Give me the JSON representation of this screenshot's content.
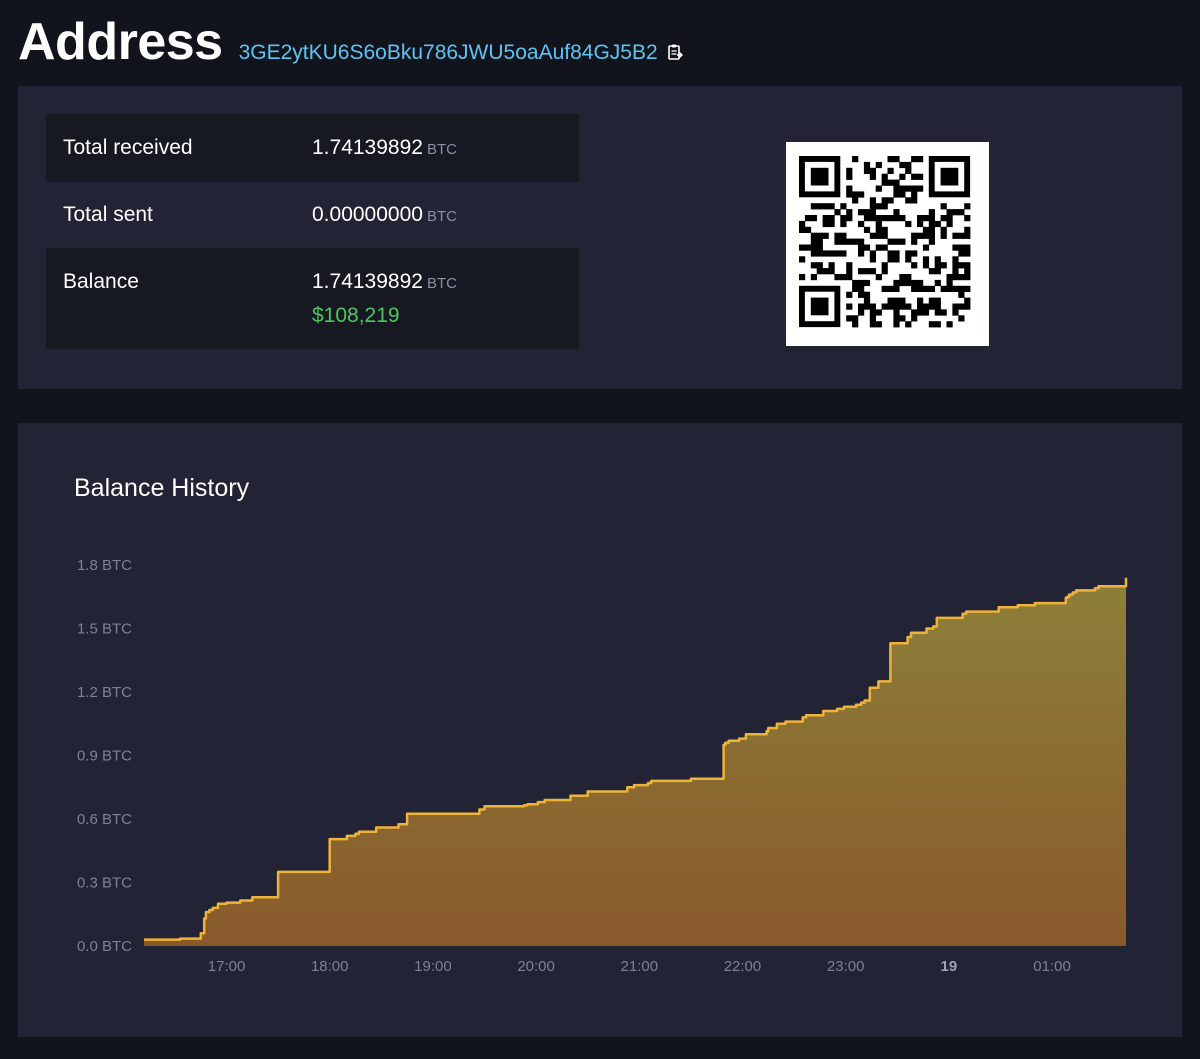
{
  "header": {
    "title": "Address",
    "address": "3GE2ytKU6S6oBku786JWU5oaAuf84GJ5B2"
  },
  "stats": {
    "total_received_label": "Total received",
    "total_received_value": "1.74139892",
    "total_sent_label": "Total sent",
    "total_sent_value": "0.00000000",
    "balance_label": "Balance",
    "balance_value": "1.74139892",
    "balance_usd": "$108,219",
    "unit": "BTC"
  },
  "colors": {
    "line": "#f0b33a",
    "usd": "#4cc75a",
    "address": "#5ec4f2"
  },
  "chart_data": {
    "type": "area",
    "title": "Balance History",
    "xlabel": "",
    "ylabel": "",
    "ylim": [
      0,
      1.8
    ],
    "yticks": [
      "0.0 BTC",
      "0.3 BTC",
      "0.6 BTC",
      "0.9 BTC",
      "1.2 BTC",
      "1.5 BTC",
      "1.8 BTC"
    ],
    "xticks": [
      "17:00",
      "18:00",
      "19:00",
      "20:00",
      "21:00",
      "22:00",
      "23:00",
      "19",
      "01:00"
    ],
    "grid": false,
    "x": [
      "16:12",
      "16:33",
      "16:45",
      "16:47",
      "16:48",
      "16:50",
      "16:52",
      "16:55",
      "17:00",
      "17:08",
      "17:15",
      "17:20",
      "17:30",
      "17:35",
      "17:52",
      "18:00",
      "18:10",
      "18:15",
      "18:17",
      "18:27",
      "18:40",
      "18:45",
      "19:00",
      "19:27",
      "19:30",
      "19:53",
      "19:55",
      "20:01",
      "20:05",
      "20:20",
      "20:30",
      "20:53",
      "20:57",
      "21:00",
      "21:05",
      "21:07",
      "21:10",
      "21:23",
      "21:27",
      "21:30",
      "21:40",
      "21:49",
      "21:50",
      "21:52",
      "21:58",
      "22:02",
      "22:14",
      "22:15",
      "22:20",
      "22:25",
      "22:30",
      "22:35",
      "22:37",
      "22:45",
      "22:47",
      "22:55",
      "22:59",
      "23:06",
      "23:09",
      "23:11",
      "23:14",
      "23:19",
      "23:26",
      "23:36",
      "23:38",
      "23:47",
      "23:51",
      "23:53",
      "24:08",
      "24:10",
      "24:29",
      "24:40",
      "24:50",
      "25:08",
      "25:09",
      "25:10",
      "25:12",
      "25:14",
      "25:25",
      "25:27",
      "25:43"
    ],
    "y": [
      0.03,
      0.035,
      0.06,
      0.13,
      0.16,
      0.17,
      0.18,
      0.2,
      0.205,
      0.215,
      0.23,
      0.23,
      0.35,
      0.35,
      0.35,
      0.505,
      0.52,
      0.53,
      0.54,
      0.56,
      0.575,
      0.625,
      0.625,
      0.645,
      0.66,
      0.665,
      0.67,
      0.68,
      0.69,
      0.71,
      0.73,
      0.75,
      0.76,
      0.76,
      0.77,
      0.78,
      0.78,
      0.78,
      0.78,
      0.79,
      0.79,
      0.95,
      0.96,
      0.97,
      0.98,
      1.0,
      1.015,
      1.03,
      1.05,
      1.06,
      1.06,
      1.08,
      1.09,
      1.09,
      1.11,
      1.12,
      1.13,
      1.14,
      1.15,
      1.16,
      1.22,
      1.25,
      1.43,
      1.46,
      1.48,
      1.5,
      1.51,
      1.55,
      1.57,
      1.58,
      1.6,
      1.61,
      1.62,
      1.645,
      1.65,
      1.66,
      1.67,
      1.68,
      1.69,
      1.7,
      1.74
    ]
  }
}
